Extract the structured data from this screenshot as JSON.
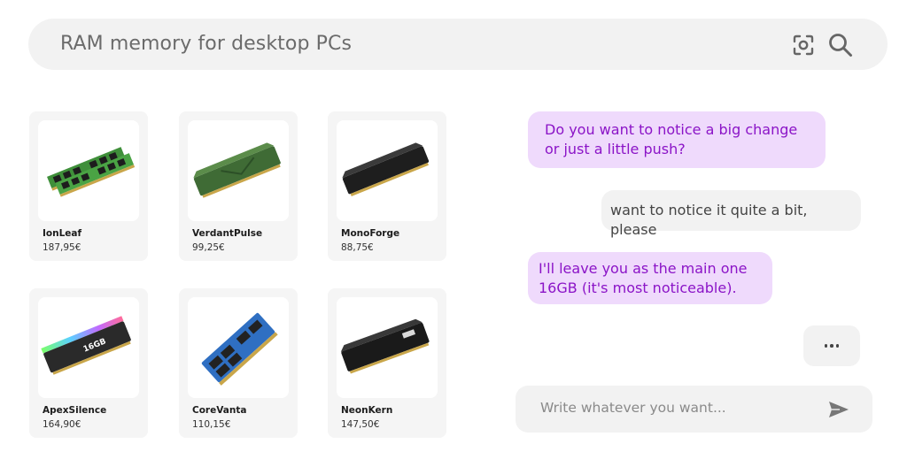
{
  "search": {
    "query": "RAM memory for desktop PCs"
  },
  "icons": {
    "lens": "camera-lens-icon",
    "search": "magnifier-icon",
    "send": "paper-plane-icon"
  },
  "products": [
    {
      "name": "IonLeaf",
      "price": "187,95€",
      "image": "green-dual-ram-sticks"
    },
    {
      "name": "VerdantPulse",
      "price": "99,25€",
      "image": "green-heatsink-ram"
    },
    {
      "name": "MonoForge",
      "price": "88,75€",
      "image": "black-heatsink-ram"
    },
    {
      "name": "ApexSilence",
      "price": "164,90€",
      "image": "rgb-16gb-ram"
    },
    {
      "name": "CoreVanta",
      "price": "110,15€",
      "image": "blue-sodimm-ram"
    },
    {
      "name": "NeonKern",
      "price": "147,50€",
      "image": "black-16gb-ram"
    }
  ],
  "chat": {
    "messages": [
      {
        "role": "assistant",
        "text": "Do you want to notice a big change or just a little push?"
      },
      {
        "role": "user",
        "text": "want to notice it quite a bit, please"
      },
      {
        "role": "assistant",
        "text": "I'll leave you as the main one 16GB (it's most noticeable)."
      }
    ],
    "typing_indicator": "...",
    "input_placeholder": "Write whatever you want..."
  },
  "colors": {
    "assistant_bubble": "#efdafc",
    "assistant_text": "#8b14c7",
    "neutral_bg": "#f2f2f2"
  }
}
